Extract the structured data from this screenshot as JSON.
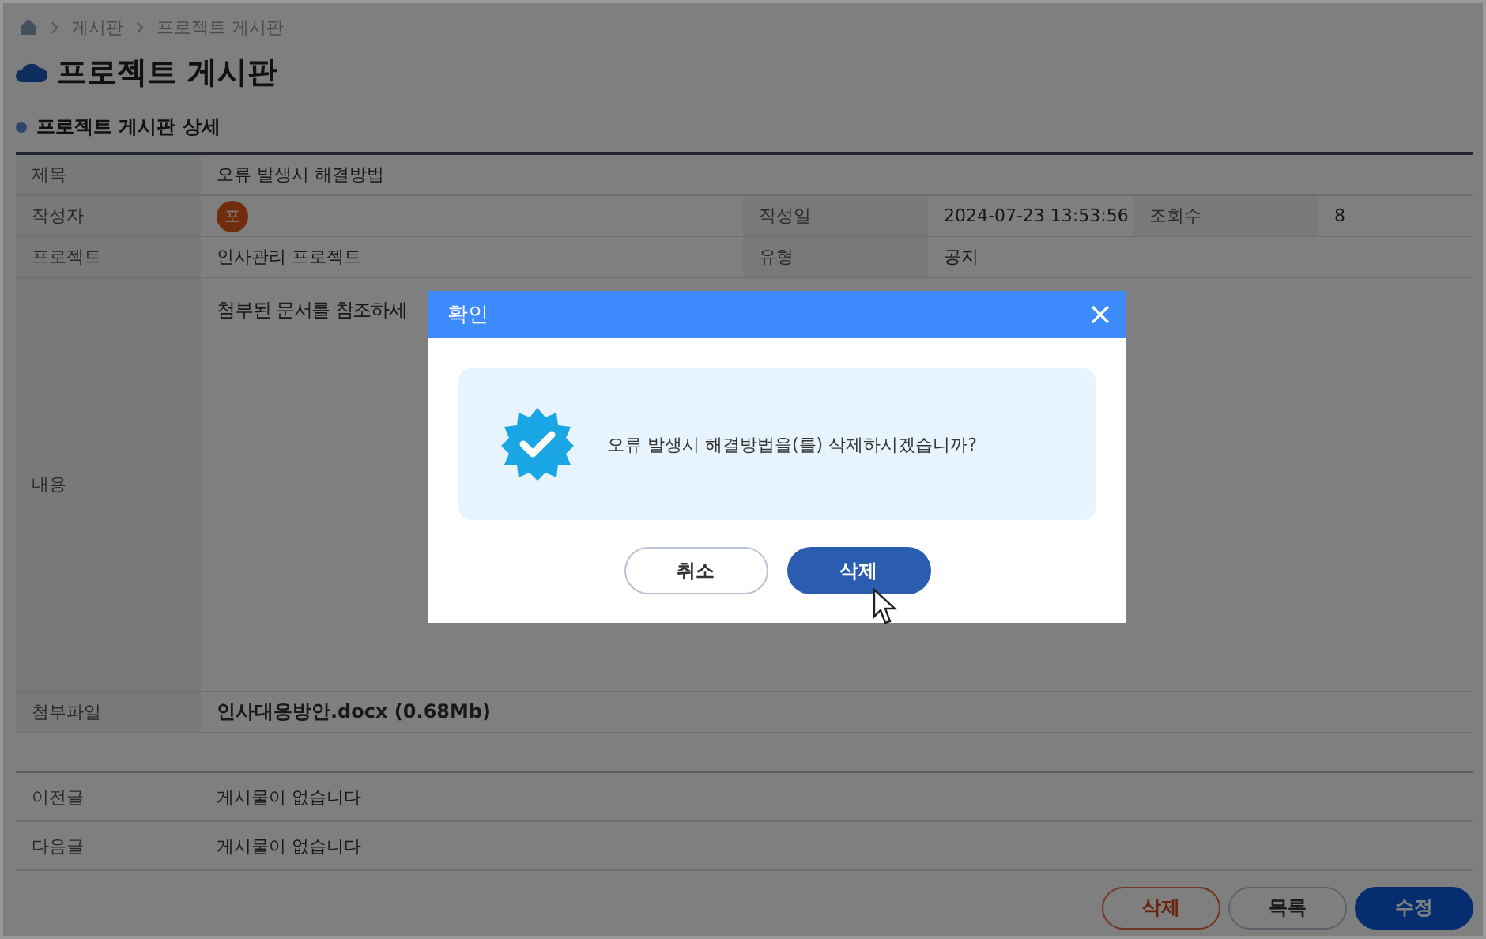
{
  "breadcrumb": [
    "게시판",
    "프로젝트 게시판"
  ],
  "page_title": "프로젝트 게시판",
  "section_title": "프로젝트 게시판 상세",
  "detail": {
    "title_label": "제목",
    "title": "오류 발생시 해결방법",
    "author_label": "작성자",
    "author_avatar": "포",
    "date_label": "작성일",
    "date": "2024-07-23 13:53:56",
    "views_label": "조회수",
    "views": "8",
    "project_label": "프로젝트",
    "project": "인사관리 프로젝트",
    "type_label": "유형",
    "type": "공지",
    "content_label": "내용",
    "content": "첨부된 문서를 참조하세",
    "file_label": "첨부파일",
    "file": "인사대응방안.docx (0.68Mb)"
  },
  "nav": [
    {
      "label": "이전글",
      "value": "게시물이 없습니다"
    },
    {
      "label": "다음글",
      "value": "게시물이 없습니다"
    }
  ],
  "buttons": [
    {
      "label": "삭제",
      "kind": "danger"
    },
    {
      "label": "목록",
      "kind": "outline"
    },
    {
      "label": "수정",
      "kind": "primary"
    }
  ],
  "dialog": {
    "title": "확인",
    "message": "오류 발생시 해결방법을(를) 삭제하시겠습니까?",
    "buttons": [
      {
        "label": "취소",
        "kind": "outline"
      },
      {
        "label": "삭제",
        "kind": "primary"
      }
    ]
  }
}
